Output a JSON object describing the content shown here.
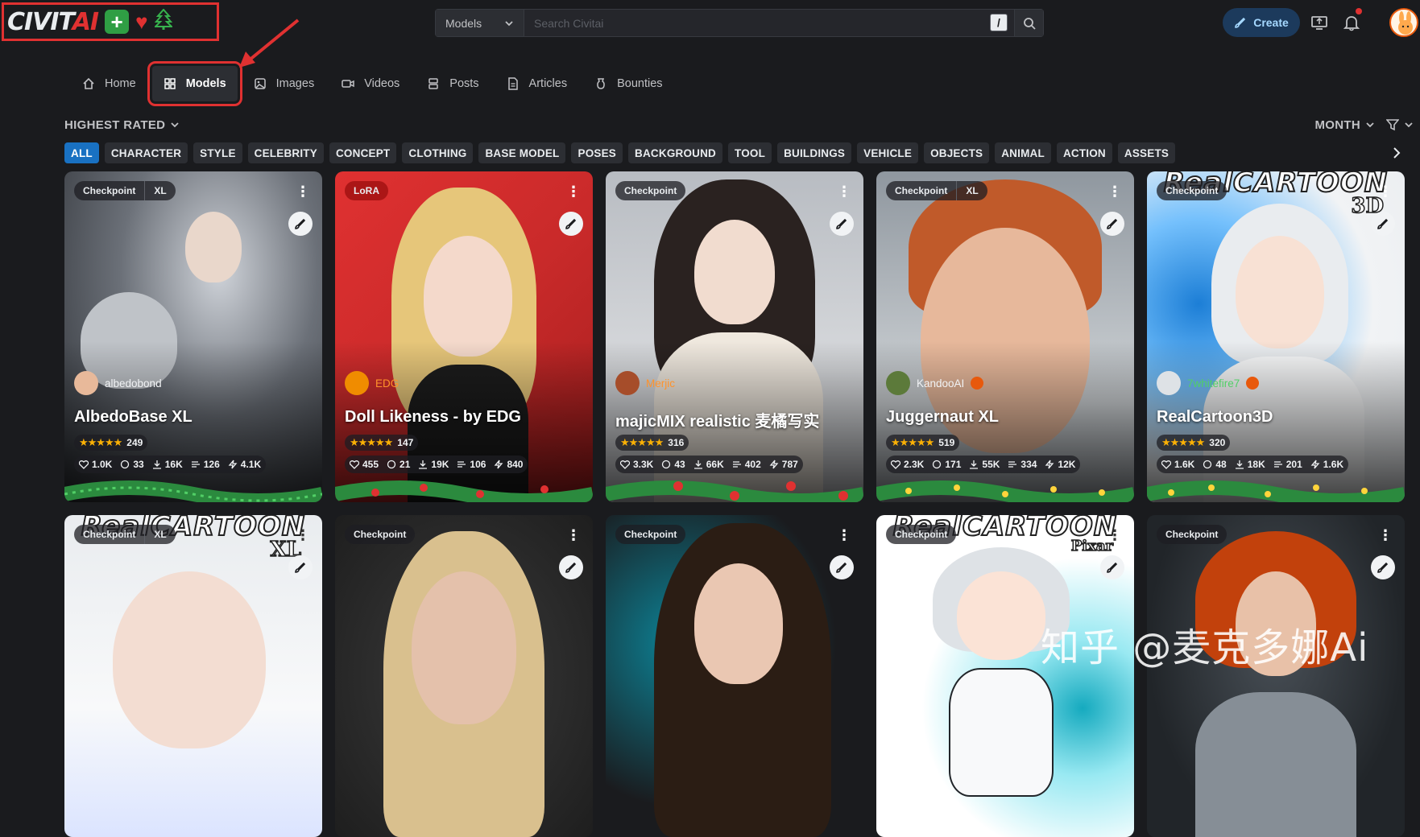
{
  "header": {
    "logo": {
      "text_main": "CIVIT",
      "text_ai": "AI",
      "plus": "+",
      "heart": "♥",
      "tree": "🌲"
    },
    "search": {
      "category": "Models",
      "placeholder": "Search Civitai",
      "shortcut": "/"
    },
    "create_label": "Create",
    "icons": [
      "upload-icon",
      "bell-icon",
      "user-avatar"
    ]
  },
  "nav": {
    "items": [
      {
        "label": "Home",
        "icon": "home-icon",
        "active": false
      },
      {
        "label": "Models",
        "icon": "grid-icon",
        "active": true
      },
      {
        "label": "Images",
        "icon": "image-icon",
        "active": false
      },
      {
        "label": "Videos",
        "icon": "video-icon",
        "active": false
      },
      {
        "label": "Posts",
        "icon": "posts-icon",
        "active": false
      },
      {
        "label": "Articles",
        "icon": "article-icon",
        "active": false
      },
      {
        "label": "Bounties",
        "icon": "bounty-icon",
        "active": false
      }
    ]
  },
  "sort": {
    "label": "HIGHEST RATED",
    "period": "MONTH"
  },
  "chips": [
    "ALL",
    "CHARACTER",
    "STYLE",
    "CELEBRITY",
    "CONCEPT",
    "CLOTHING",
    "BASE MODEL",
    "POSES",
    "BACKGROUND",
    "TOOL",
    "BUILDINGS",
    "VEHICLE",
    "OBJECTS",
    "ANIMAL",
    "ACTION",
    "ASSETS"
  ],
  "cards_row1": [
    {
      "type": "Checkpoint",
      "base": "XL",
      "creator": "albedobond",
      "name": "AlbedoBase XL",
      "rating_count": "249",
      "likes": "1.0K",
      "comments": "33",
      "downloads": "16K",
      "generations": "126",
      "buzz": "4.1K"
    },
    {
      "type": "LoRA",
      "base": "",
      "creator": "EDG",
      "name": "Doll Likeness - by EDG",
      "rating_count": "147",
      "likes": "455",
      "comments": "21",
      "downloads": "19K",
      "generations": "106",
      "buzz": "840"
    },
    {
      "type": "Checkpoint",
      "base": "",
      "creator": "Merjic",
      "name": "majicMIX realistic 麦橘写实",
      "rating_count": "316",
      "likes": "3.3K",
      "comments": "43",
      "downloads": "66K",
      "generations": "402",
      "buzz": "787"
    },
    {
      "type": "Checkpoint",
      "base": "XL",
      "creator": "KandooAI",
      "name": "Juggernaut XL",
      "rating_count": "519",
      "likes": "2.3K",
      "comments": "171",
      "downloads": "55K",
      "generations": "334",
      "buzz": "12K"
    },
    {
      "type": "Checkpoint",
      "base": "",
      "creator": "7whitefire7",
      "name": "RealCartoon3D",
      "rating_count": "320",
      "likes": "1.6K",
      "comments": "48",
      "downloads": "18K",
      "generations": "201",
      "buzz": "1.6K"
    }
  ],
  "cards_row2": [
    {
      "type": "Checkpoint",
      "base": "XL",
      "banner": "RealCARTOON",
      "banner_sub": "XL"
    },
    {
      "type": "Checkpoint",
      "base": "",
      "banner": "",
      "banner_sub": ""
    },
    {
      "type": "Checkpoint",
      "base": "",
      "banner": "",
      "banner_sub": ""
    },
    {
      "type": "Checkpoint",
      "base": "",
      "banner": "RealCARTOON",
      "banner_sub": "Pixar"
    },
    {
      "type": "Checkpoint",
      "base": "",
      "banner": "",
      "banner_sub": ""
    }
  ],
  "row1_banner": {
    "card5_text": "RealCARTOON",
    "card5_sub": "3D"
  },
  "stars": "★★★★★",
  "watermark": "知乎 @麦克多娜Ai",
  "colors": {
    "accent": "#1971c2",
    "annotation": "#e03131",
    "star": "#fab005",
    "background": "#1a1b1e"
  }
}
